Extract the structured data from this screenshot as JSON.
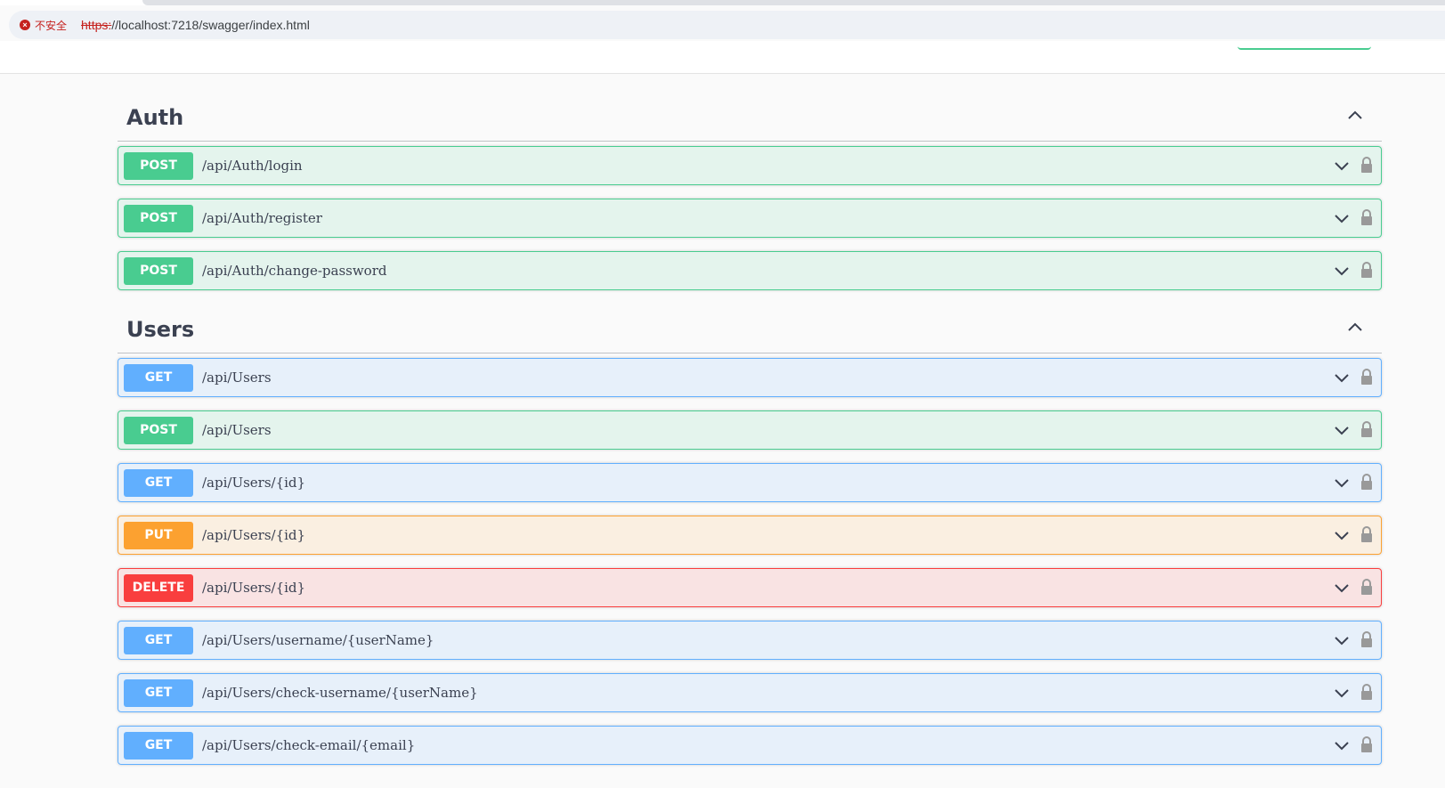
{
  "browser": {
    "insecure_label": "不安全",
    "url_scheme": "https:",
    "url_rest": "//localhost:7218/swagger/index.html"
  },
  "sections": [
    {
      "title": "Auth",
      "operations": [
        {
          "method": "POST",
          "path": "/api/Auth/login"
        },
        {
          "method": "POST",
          "path": "/api/Auth/register"
        },
        {
          "method": "POST",
          "path": "/api/Auth/change-password"
        }
      ]
    },
    {
      "title": "Users",
      "operations": [
        {
          "method": "GET",
          "path": "/api/Users"
        },
        {
          "method": "POST",
          "path": "/api/Users"
        },
        {
          "method": "GET",
          "path": "/api/Users/{id}"
        },
        {
          "method": "PUT",
          "path": "/api/Users/{id}"
        },
        {
          "method": "DELETE",
          "path": "/api/Users/{id}"
        },
        {
          "method": "GET",
          "path": "/api/Users/username/{userName}"
        },
        {
          "method": "GET",
          "path": "/api/Users/check-username/{userName}"
        },
        {
          "method": "GET",
          "path": "/api/Users/check-email/{email}"
        }
      ]
    }
  ],
  "colors": {
    "post": "#49cc90",
    "get": "#61affe",
    "put": "#fca130",
    "delete": "#f93e3e"
  },
  "icons": {
    "section_toggle": "chevron-up-icon",
    "operation_toggle": "chevron-down-icon",
    "auth": "lock-icon"
  }
}
